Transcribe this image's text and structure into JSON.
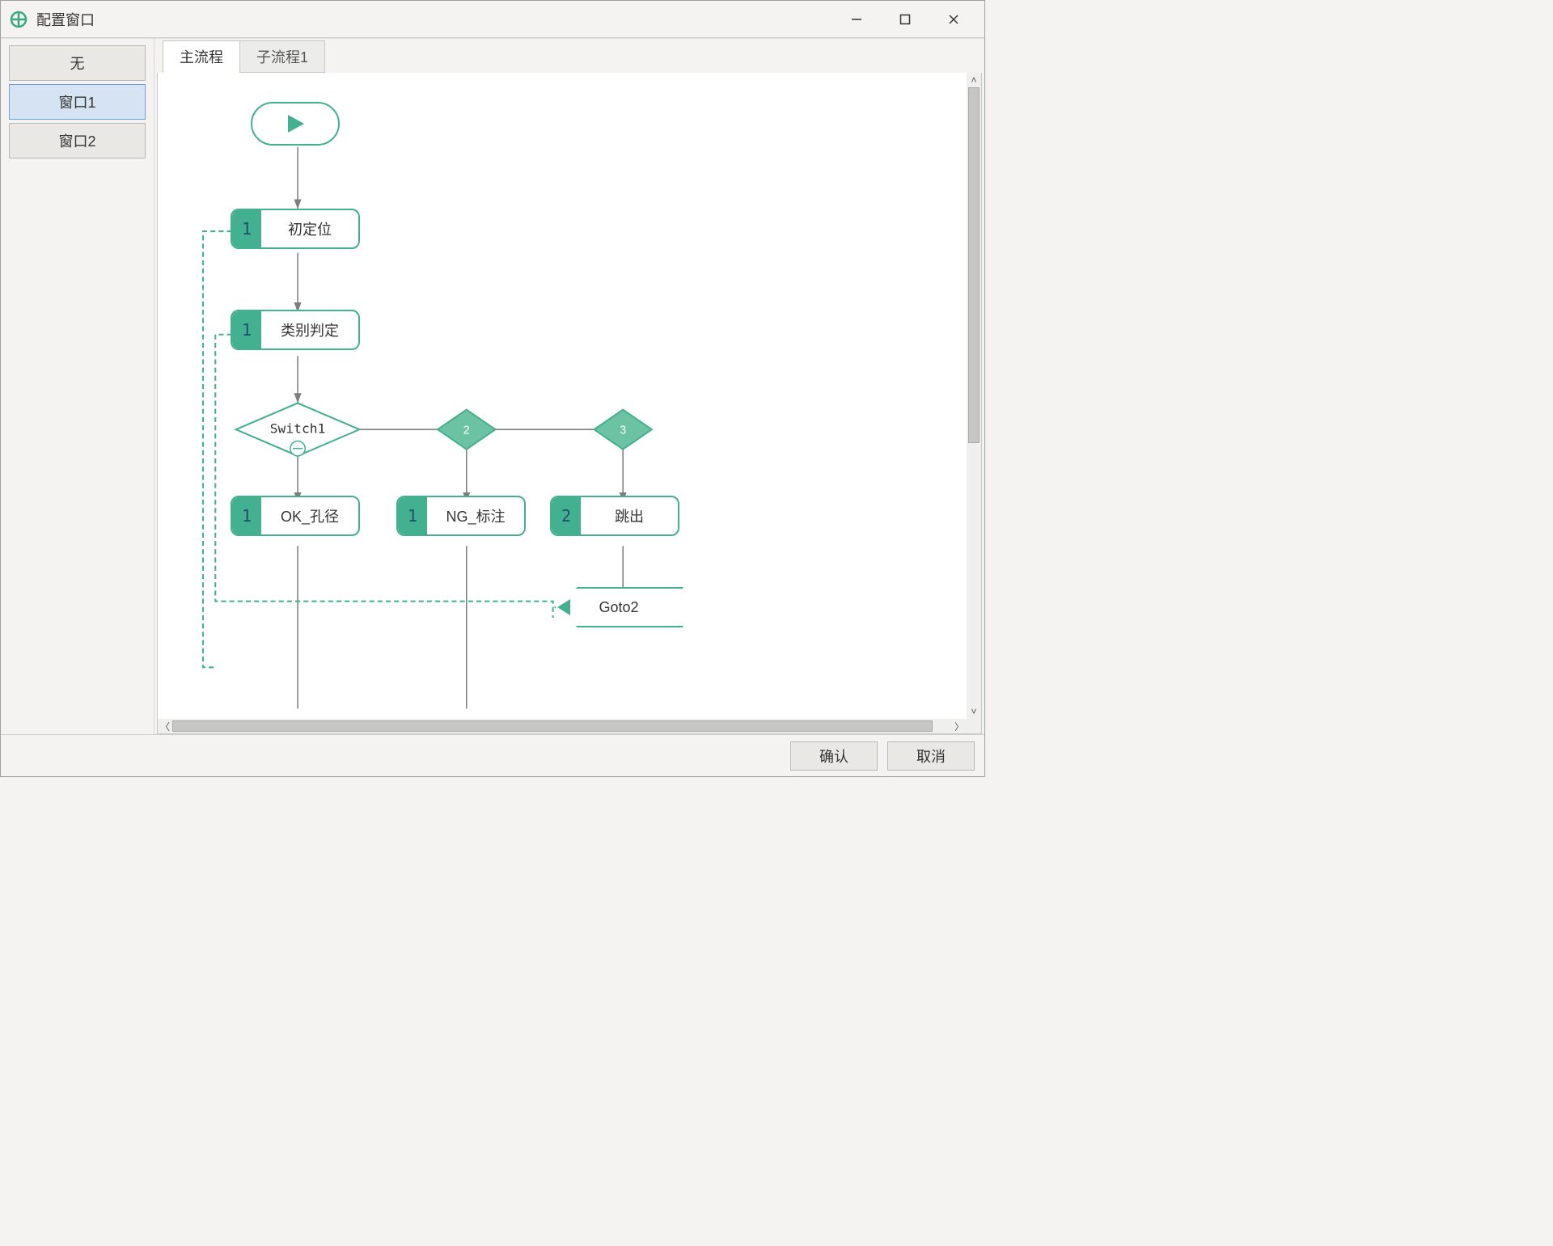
{
  "window": {
    "title": "配置窗口"
  },
  "sidebar": {
    "items": [
      {
        "label": "无"
      },
      {
        "label": "窗口1"
      },
      {
        "label": "窗口2"
      }
    ]
  },
  "tabs": [
    {
      "label": "主流程"
    },
    {
      "label": "子流程1"
    }
  ],
  "flow": {
    "nodes": {
      "start": {
        "type": "start"
      },
      "n1": {
        "num": "1",
        "label": "初定位"
      },
      "n2": {
        "num": "1",
        "label": "类别判定"
      },
      "switch": {
        "label": "Switch1"
      },
      "d2": {
        "label": "2"
      },
      "d3": {
        "label": "3"
      },
      "b1": {
        "num": "1",
        "label": "OK_孔径"
      },
      "b2": {
        "num": "1",
        "label": "NG_标注"
      },
      "b3": {
        "num": "2",
        "label": "跳出"
      },
      "goto": {
        "label": "Goto2"
      }
    }
  },
  "footer": {
    "ok": "确认",
    "cancel": "取消"
  },
  "colors": {
    "accent": "#43b08f",
    "accent_fill": "#6bc3a4"
  }
}
